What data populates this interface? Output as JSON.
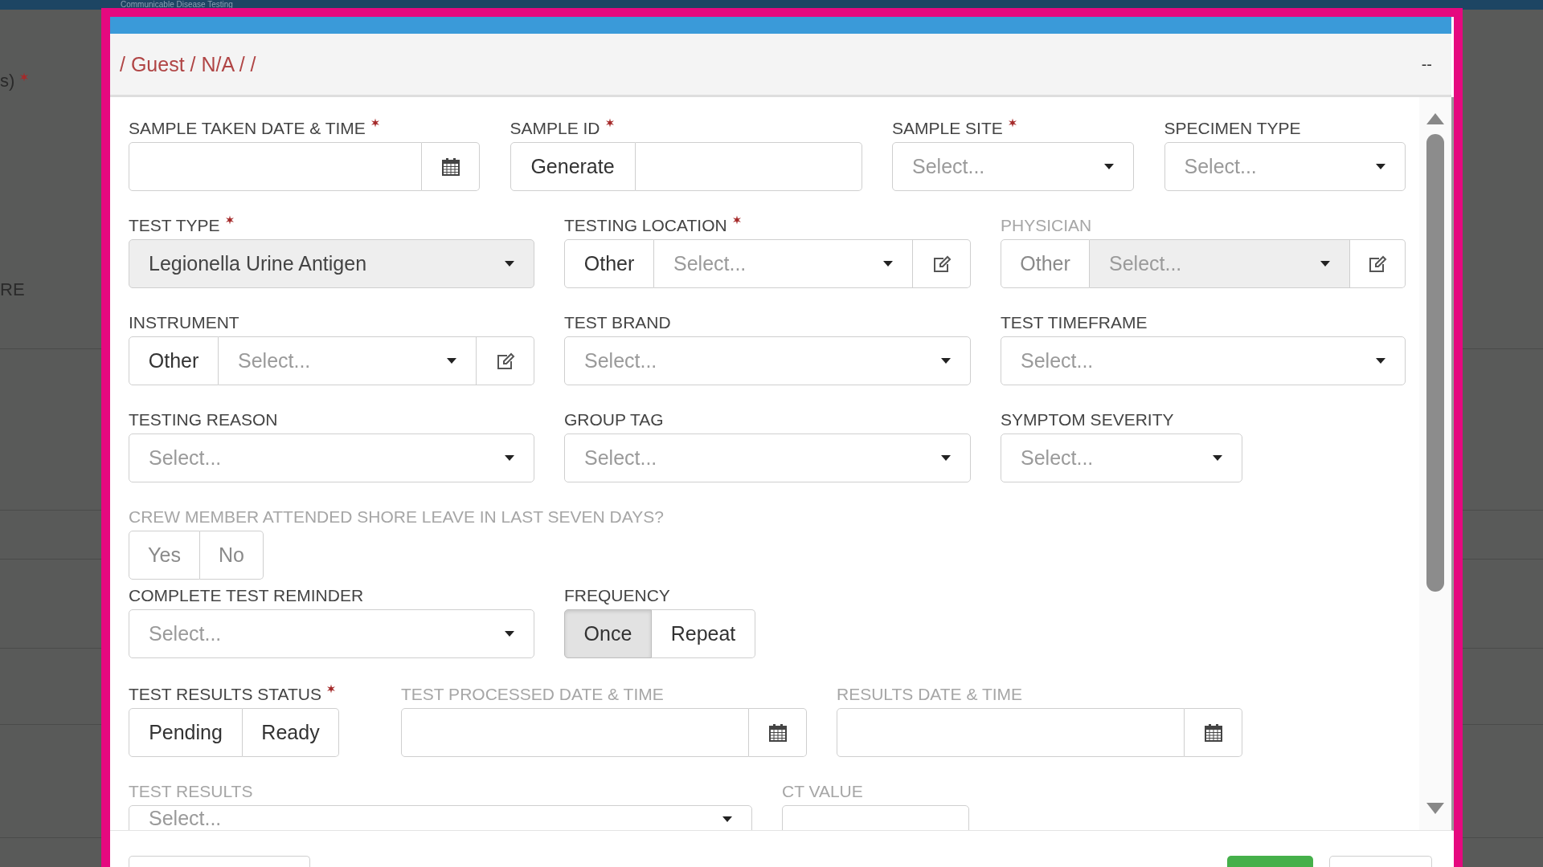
{
  "page": {
    "title": "Communicable Disease Testing",
    "side_labels": [
      {
        "text": "s)",
        "required": true
      },
      {
        "text": "RE",
        "required": false
      }
    ]
  },
  "modal": {
    "breadcrumb": "/ Guest / N/A / /",
    "header_right": "--",
    "rows": [
      {
        "fields": [
          {
            "kind": "date",
            "label": "SAMPLE TAKEN DATE & TIME",
            "required": true,
            "dimmed": false
          },
          {
            "kind": "generate",
            "label": "SAMPLE ID",
            "required": true,
            "dimmed": false,
            "button": "Generate"
          },
          {
            "kind": "select",
            "label": "SAMPLE SITE",
            "required": true,
            "dimmed": false,
            "disabled": false,
            "placeholder": "Select..."
          },
          {
            "kind": "select",
            "label": "SPECIMEN TYPE",
            "required": false,
            "dimmed": false,
            "disabled": false,
            "placeholder": "Select..."
          }
        ]
      },
      {
        "fields": [
          {
            "kind": "select",
            "label": "TEST TYPE",
            "required": true,
            "dimmed": false,
            "disabled": true,
            "value": "Legionella Urine Antigen"
          },
          {
            "kind": "other_select",
            "label": "TESTING LOCATION",
            "required": true,
            "dimmed": false,
            "disabled": false,
            "other": "Other",
            "placeholder": "Select..."
          },
          {
            "kind": "other_select",
            "label": "PHYSICIAN",
            "required": false,
            "dimmed": true,
            "disabled": true,
            "other": "Other",
            "placeholder": "Select..."
          }
        ]
      },
      {
        "fields": [
          {
            "kind": "other_select",
            "label": "INSTRUMENT",
            "required": false,
            "dimmed": false,
            "disabled": false,
            "other": "Other",
            "placeholder": "Select..."
          },
          {
            "kind": "select",
            "label": "TEST BRAND",
            "required": false,
            "dimmed": false,
            "disabled": false,
            "placeholder": "Select..."
          },
          {
            "kind": "select",
            "label": "TEST TIMEFRAME",
            "required": false,
            "dimmed": false,
            "disabled": false,
            "placeholder": "Select..."
          }
        ]
      },
      {
        "fields": [
          {
            "kind": "select",
            "label": "TESTING REASON",
            "required": false,
            "dimmed": false,
            "disabled": false,
            "placeholder": "Select..."
          },
          {
            "kind": "select",
            "label": "GROUP TAG",
            "required": false,
            "dimmed": false,
            "disabled": false,
            "placeholder": "Select..."
          },
          {
            "kind": "select",
            "label": "SYMPTOM SEVERITY",
            "required": false,
            "dimmed": false,
            "disabled": false,
            "placeholder": "Select..."
          }
        ]
      },
      {
        "fields": [
          {
            "kind": "toggle",
            "label": "CREW MEMBER ATTENDED SHORE LEAVE IN LAST SEVEN DAYS?",
            "required": false,
            "dimmed": true,
            "disabled": true,
            "options": [
              {
                "label": "Yes",
                "selected": false
              },
              {
                "label": "No",
                "selected": false
              }
            ]
          }
        ]
      },
      {
        "fields": [
          {
            "kind": "select",
            "label": "COMPLETE TEST REMINDER",
            "required": false,
            "dimmed": false,
            "disabled": false,
            "placeholder": "Select..."
          },
          {
            "kind": "toggle",
            "label": "FREQUENCY",
            "required": false,
            "dimmed": false,
            "disabled": false,
            "options": [
              {
                "label": "Once",
                "selected": true
              },
              {
                "label": "Repeat",
                "selected": false
              }
            ]
          }
        ]
      },
      {
        "fields": [
          {
            "kind": "toggle",
            "label": "TEST RESULTS STATUS",
            "required": true,
            "dimmed": false,
            "disabled": false,
            "options": [
              {
                "label": "Pending",
                "selected": false
              },
              {
                "label": "Ready",
                "selected": false
              }
            ]
          },
          {
            "kind": "date",
            "label": "TEST PROCESSED DATE & TIME",
            "required": false,
            "dimmed": true
          },
          {
            "kind": "date",
            "label": "RESULTS DATE & TIME",
            "required": false,
            "dimmed": true
          }
        ]
      },
      {
        "fields": [
          {
            "kind": "select",
            "label": "TEST RESULTS",
            "required": false,
            "dimmed": true,
            "disabled": false,
            "placeholder": "Select..."
          },
          {
            "kind": "text",
            "label": "CT VALUE",
            "required": false,
            "dimmed": true
          }
        ]
      }
    ]
  }
}
